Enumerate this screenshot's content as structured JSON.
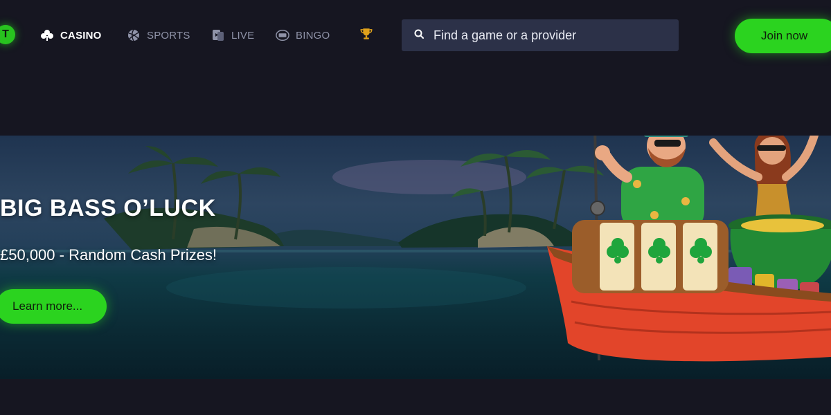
{
  "logo": {
    "letter": "T",
    "color": "#28c21f"
  },
  "nav": {
    "items": [
      {
        "label": "CASINO",
        "icon": "clover-icon",
        "active": true
      },
      {
        "label": "SPORTS",
        "icon": "volleyball-icon",
        "active": false
      },
      {
        "label": "LIVE",
        "icon": "live-cards-icon",
        "active": false
      },
      {
        "label": "BINGO",
        "icon": "bingo-ball-icon",
        "active": false
      }
    ],
    "trophy_icon": "trophy-icon"
  },
  "search": {
    "placeholder": "Find a game or a provider",
    "icon": "search-icon"
  },
  "header": {
    "join_label": "Join now"
  },
  "hero": {
    "title": "BIG BASS O’LUCK",
    "subtitle": "£50,000 - Random Cash Prizes!",
    "cta_label": "Learn more..."
  },
  "colors": {
    "background": "#161621",
    "accent_green": "#2bd31f",
    "search_bg": "#2c3148",
    "nav_inactive": "#8f93a8"
  }
}
